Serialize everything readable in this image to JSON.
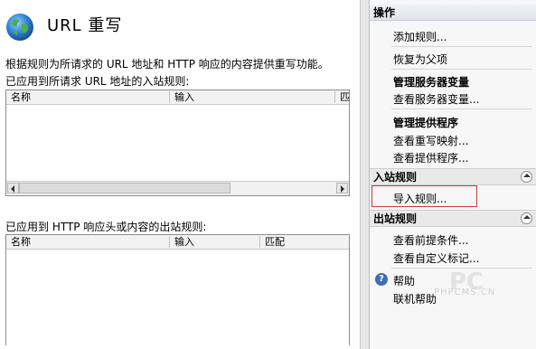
{
  "header": {
    "title": "URL  重写",
    "icon": "globe-icon"
  },
  "description": "根据规则为所请求的 URL 地址和 HTTP 响应的内容提供重写功能。",
  "inbound": {
    "caption": "已应用到所请求 URL 地址的入站规则:",
    "columns": [
      "名称",
      "输入",
      "匹"
    ]
  },
  "outbound": {
    "caption": "已应用到 HTTP 响应头或内容的出站规则:",
    "columns": [
      "名称",
      "输入",
      "匹配"
    ]
  },
  "actions": {
    "title": "操作",
    "add_rule": "添加规则...",
    "revert_parent": "恢复为父项",
    "server_vars_head": "管理服务器变量",
    "view_server_vars": "查看服务器变量...",
    "providers_head": "管理提供程序",
    "view_rewrite_maps": "查看重写映射...",
    "view_providers": "查看提供程序...",
    "inbound_head": "入站规则",
    "import_rules": "导入规则...",
    "outbound_head": "出站规则",
    "view_preconditions": "查看前提条件...",
    "view_custom_tags": "查看自定义标记...",
    "help": "帮助",
    "online_help": "联机帮助"
  },
  "watermark": {
    "logo": "PC",
    "text": "PHPCMS.CN"
  },
  "colors": {
    "highlight": "#d23a3a",
    "help_icon": "#3e6db7"
  }
}
